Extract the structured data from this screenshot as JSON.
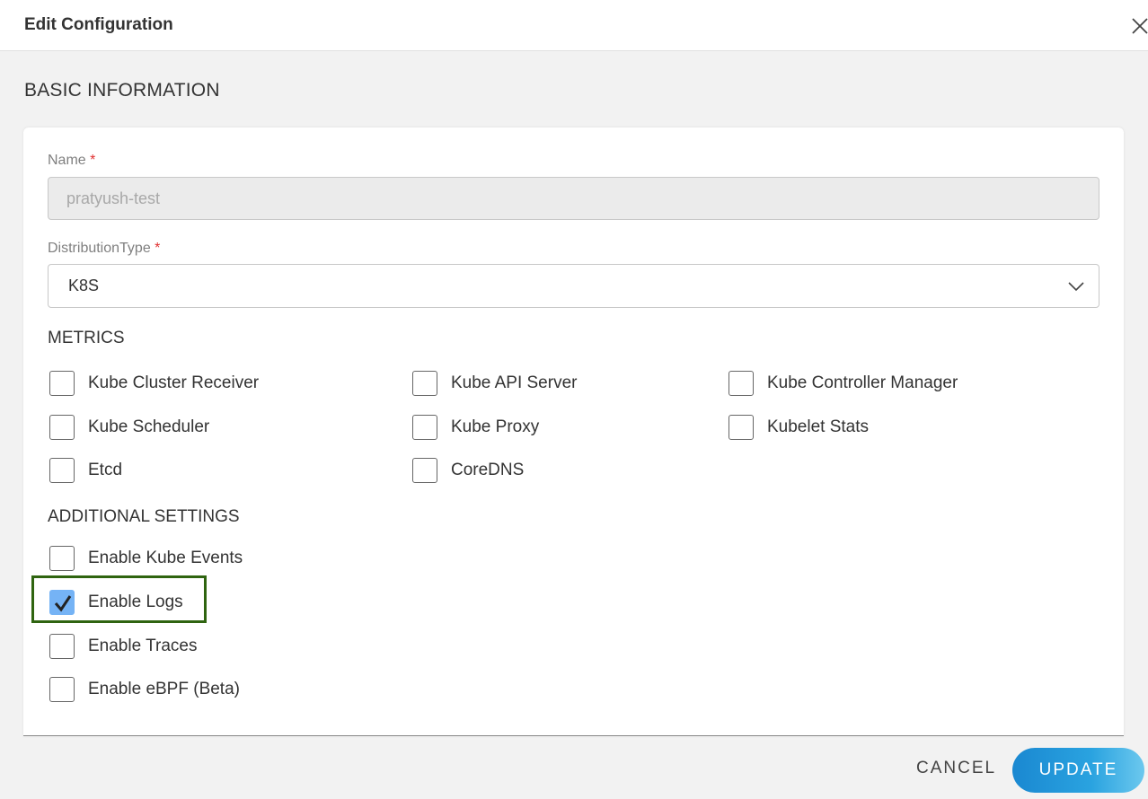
{
  "header": {
    "title": "Edit Configuration"
  },
  "section": {
    "title": "BASIC INFORMATION"
  },
  "form": {
    "name_label": "Name",
    "required_mark": "*",
    "name_value": "pratyush-test",
    "distribution_label": "DistributionType",
    "distribution_value": "K8S"
  },
  "metrics": {
    "title": "METRICS",
    "items": [
      {
        "label": "Kube Cluster Receiver",
        "checked": false
      },
      {
        "label": "Kube API Server",
        "checked": false
      },
      {
        "label": "Kube Controller Manager",
        "checked": false
      },
      {
        "label": "Kube Scheduler",
        "checked": false
      },
      {
        "label": "Kube Proxy",
        "checked": false
      },
      {
        "label": "Kubelet Stats",
        "checked": false
      },
      {
        "label": "Etcd",
        "checked": false
      },
      {
        "label": "CoreDNS",
        "checked": false
      }
    ]
  },
  "additional": {
    "title": "ADDITIONAL SETTINGS",
    "items": [
      {
        "label": "Enable Kube Events",
        "checked": false
      },
      {
        "label": "Enable Logs",
        "checked": true
      },
      {
        "label": "Enable Traces",
        "checked": false
      },
      {
        "label": "Enable eBPF (Beta)",
        "checked": false
      }
    ]
  },
  "footer": {
    "cancel_label": "CANCEL",
    "update_label": "UPDATE"
  },
  "colors": {
    "checkbox_checked": "#75b3f5",
    "highlight_border": "#2f6410",
    "update_button": "#1a88d1",
    "required": "#e03030"
  },
  "icons": {
    "close": "close-icon",
    "chevron": "chevron-down-icon",
    "check": "checkmark-icon"
  }
}
